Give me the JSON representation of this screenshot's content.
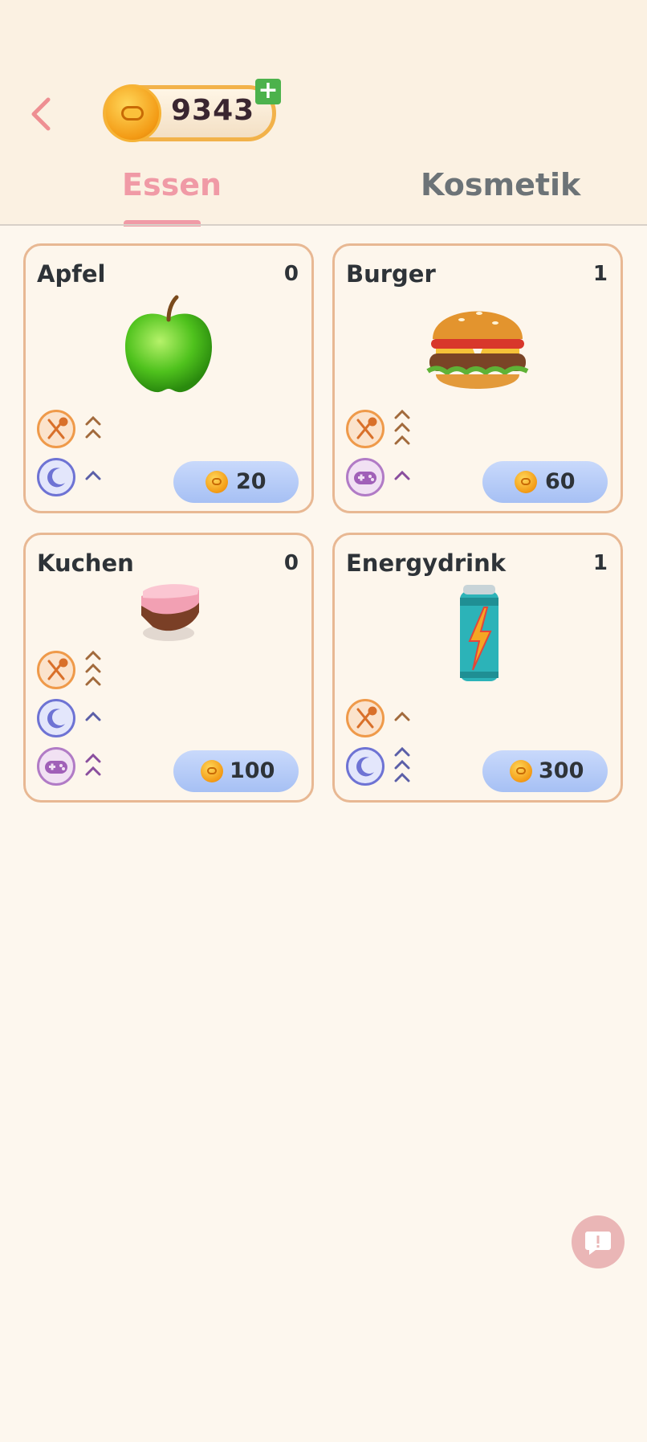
{
  "header": {
    "coins": "9343"
  },
  "tabs": [
    {
      "label": "Essen",
      "active": true
    },
    {
      "label": "Kosmetik",
      "active": false
    }
  ],
  "items": [
    {
      "name": "Apfel",
      "count": "0",
      "price": "20",
      "image": "green-apple",
      "stats": [
        {
          "icon": "fork-spoon-icon",
          "level": 2
        },
        {
          "icon": "moon-icon",
          "level": 1
        }
      ]
    },
    {
      "name": "Burger",
      "count": "1",
      "price": "60",
      "image": "burger",
      "stats": [
        {
          "icon": "fork-spoon-icon",
          "level": 3
        },
        {
          "icon": "gamepad-icon",
          "level": 1
        }
      ]
    },
    {
      "name": "Kuchen",
      "count": "0",
      "price": "100",
      "image": "cake-slice",
      "stats": [
        {
          "icon": "fork-spoon-icon",
          "level": 3
        },
        {
          "icon": "moon-icon",
          "level": 1
        },
        {
          "icon": "gamepad-icon",
          "level": 2
        }
      ]
    },
    {
      "name": "Energydrink",
      "count": "1",
      "price": "300",
      "image": "energy-drink-can",
      "stats": [
        {
          "icon": "fork-spoon-icon",
          "level": 1
        },
        {
          "icon": "moon-icon",
          "level": 3
        }
      ]
    }
  ],
  "colors": {
    "accent": "#f09aa6",
    "card_border": "#e8b893",
    "price_button": "#b5cdf8",
    "feedback": "#eab6b6"
  }
}
